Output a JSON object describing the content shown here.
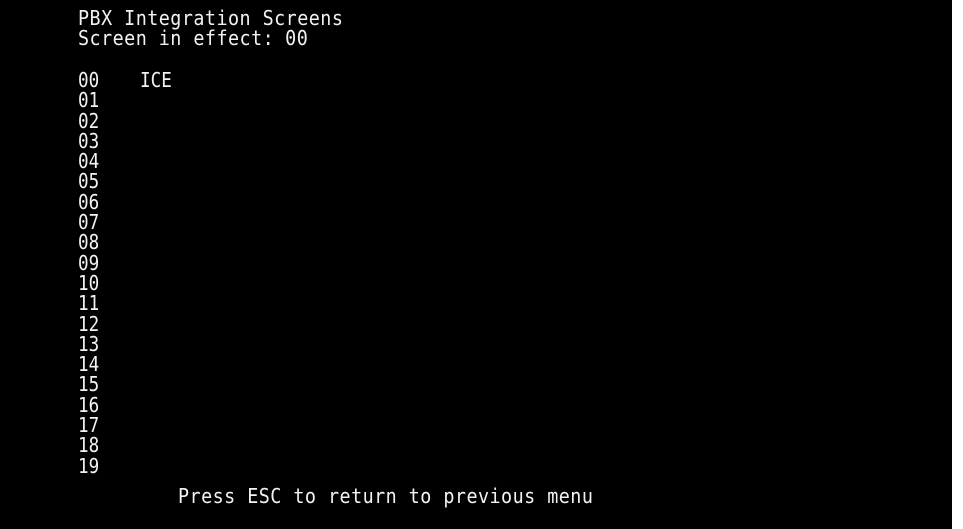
{
  "header": {
    "title": "PBX Integration Screens",
    "status_label": "Screen in effect:",
    "status_value": "00"
  },
  "screens": [
    {
      "number": "00",
      "name": "ICE"
    },
    {
      "number": "01",
      "name": ""
    },
    {
      "number": "02",
      "name": ""
    },
    {
      "number": "03",
      "name": ""
    },
    {
      "number": "04",
      "name": ""
    },
    {
      "number": "05",
      "name": ""
    },
    {
      "number": "06",
      "name": ""
    },
    {
      "number": "07",
      "name": ""
    },
    {
      "number": "08",
      "name": ""
    },
    {
      "number": "09",
      "name": ""
    },
    {
      "number": "10",
      "name": ""
    },
    {
      "number": "11",
      "name": ""
    },
    {
      "number": "12",
      "name": ""
    },
    {
      "number": "13",
      "name": ""
    },
    {
      "number": "14",
      "name": ""
    },
    {
      "number": "15",
      "name": ""
    },
    {
      "number": "16",
      "name": ""
    },
    {
      "number": "17",
      "name": ""
    },
    {
      "number": "18",
      "name": ""
    },
    {
      "number": "19",
      "name": ""
    }
  ],
  "footer": {
    "hint": "Press ESC to return to previous menu"
  },
  "colors": {
    "background": "#000000",
    "text": "#f2f2f2"
  }
}
